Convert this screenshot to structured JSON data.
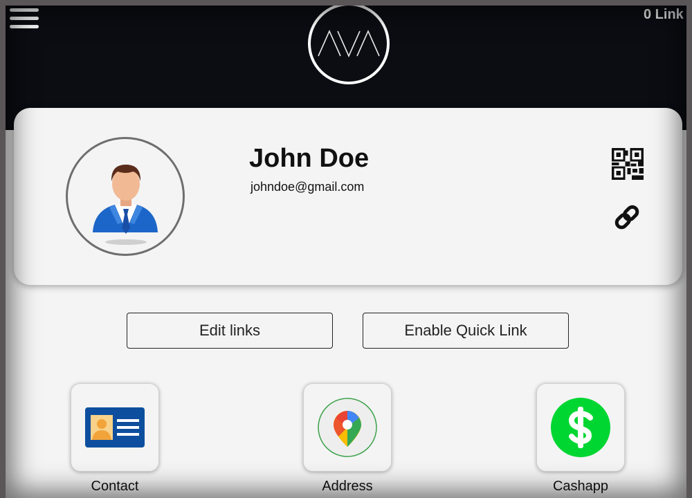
{
  "header": {
    "logo_text": "AVA",
    "link_count": "0 Link"
  },
  "profile": {
    "name": "John Doe",
    "email": "johndoe@gmail.com"
  },
  "actions": {
    "edit_links": "Edit links",
    "enable_quick_link": "Enable Quick Link"
  },
  "links": [
    {
      "label": "Contact",
      "icon": "contact-card-icon"
    },
    {
      "label": "Address",
      "icon": "google-maps-icon"
    },
    {
      "label": "Cashapp",
      "icon": "cashapp-icon"
    }
  ],
  "colors": {
    "header_bg": "#0b0d13",
    "page_bg": "#f4f4f4",
    "cashapp_green": "#00d632",
    "contact_blue": "#0d4f9e"
  }
}
